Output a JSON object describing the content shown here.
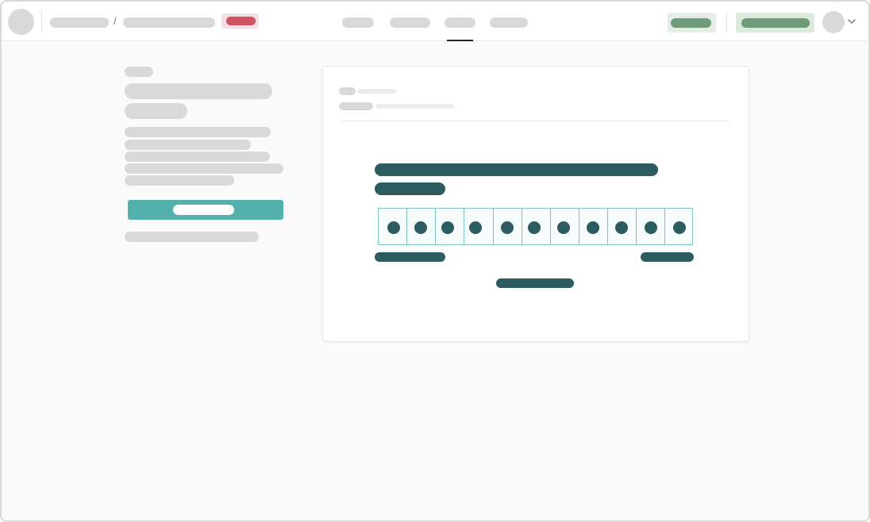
{
  "header": {
    "breadcrumb_separator": "/"
  },
  "icons": {
    "chevron": "chevron-down-icon"
  },
  "colors": {
    "accent_teal": "#53b1ad",
    "dark_teal": "#2d5c60",
    "success_green": "#6e9c79",
    "danger_red": "#d25261"
  },
  "digit_boxes": 11
}
